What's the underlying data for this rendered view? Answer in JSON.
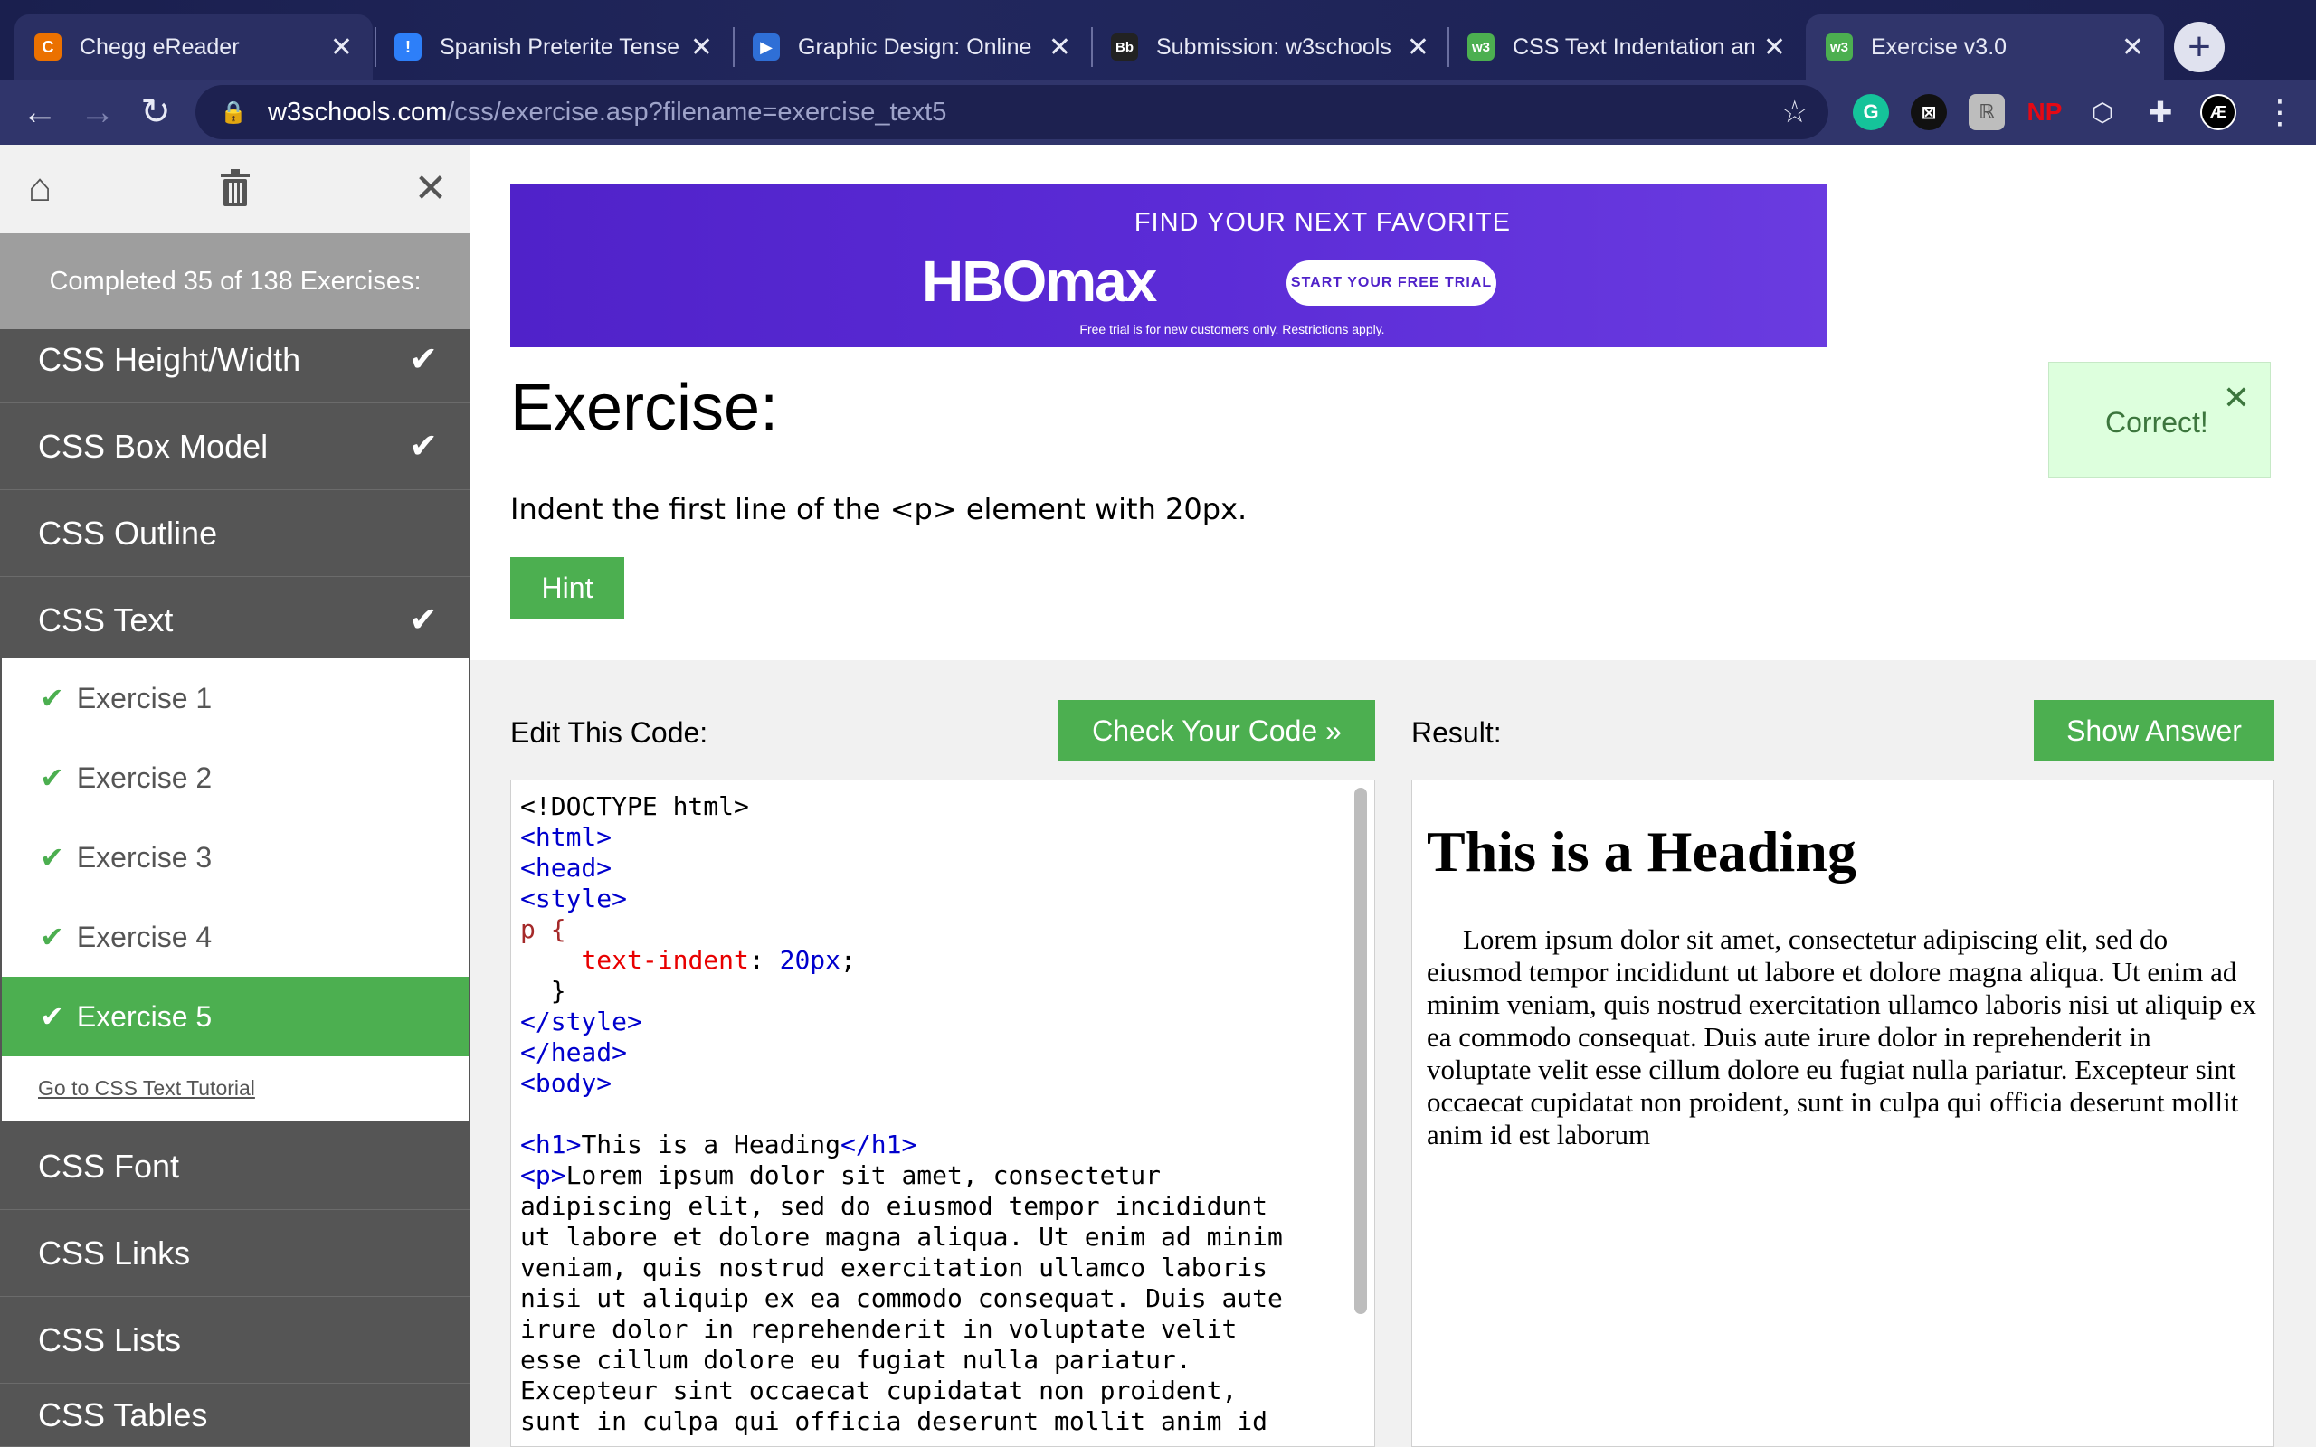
{
  "browser": {
    "tabs": [
      {
        "title": "Chegg eReader",
        "favicon": "C",
        "favicon_color": "#eb7100"
      },
      {
        "title": "Spanish Preterite Tense",
        "favicon": "!",
        "favicon_color": "#2d7ff9"
      },
      {
        "title": "Graphic Design: Online",
        "favicon": "▶",
        "favicon_color": "#2f6fd6"
      },
      {
        "title": "Submission: w3schools",
        "favicon": "Bb",
        "favicon_color": "#222222"
      },
      {
        "title": "CSS Text Indentation an",
        "favicon": "w3",
        "favicon_color": "#4caf50"
      },
      {
        "title": "Exercise v3.0",
        "favicon": "w3",
        "favicon_color": "#4caf50"
      }
    ],
    "url_host": "w3schools.com",
    "url_path": "/css/exercise.asp?filename=exercise_text5",
    "extensions": [
      "G",
      "⊠",
      "ℝ",
      "NP",
      "⬡",
      "✚",
      "Æ"
    ]
  },
  "sidebar": {
    "progress": "Completed 35 of 138 Exercises:",
    "topics_top": [
      {
        "label": "CSS Height/Width",
        "done": "✔"
      },
      {
        "label": "CSS Box Model",
        "done": "✔"
      },
      {
        "label": "CSS Outline",
        "done": ""
      },
      {
        "label": "CSS Text",
        "done": "✔"
      }
    ],
    "subitems": [
      {
        "label": "Exercise 1"
      },
      {
        "label": "Exercise 2"
      },
      {
        "label": "Exercise 3"
      },
      {
        "label": "Exercise 4"
      },
      {
        "label": "Exercise 5"
      }
    ],
    "tutorial_link": "Go to CSS Text Tutorial",
    "topics_bottom": [
      {
        "label": "CSS Font"
      },
      {
        "label": "CSS Links"
      },
      {
        "label": "CSS Lists"
      },
      {
        "label": "CSS Tables"
      }
    ]
  },
  "ad": {
    "line1": "FIND YOUR NEXT FAVORITE",
    "logo": "HBOmax",
    "cta": "START YOUR FREE TRIAL",
    "fine": "Free trial is for new customers only. Restrictions apply."
  },
  "exercise": {
    "title": "Exercise:",
    "description": "Indent the first line of the <p> element with 20px.",
    "hint": "Hint",
    "correct": "Correct!",
    "edit_label": "Edit This Code:",
    "check_button": "Check Your Code »",
    "result_label": "Result:",
    "answer_button": "Show Answer"
  },
  "code": {
    "doctype": "<!DOCTYPE html>",
    "html_open": "<html>",
    "head_open": "<head>",
    "style_open": "<style>",
    "selector": "p {",
    "prop": "text-indent",
    "value": "20px",
    "close_brace": "}",
    "style_close": "</style>",
    "head_close": "</head>",
    "body_open": "<body>",
    "h1_open": "<h1>",
    "h1_text": "This is a Heading",
    "h1_close": "</h1>",
    "p_open": "<p>",
    "p_lines": [
      "Lorem ipsum dolor sit amet, consectetur",
      "adipiscing elit, sed do eiusmod tempor incididunt",
      "ut labore et dolore magna aliqua. Ut enim ad minim",
      "veniam, quis nostrud exercitation ullamco laboris",
      "nisi ut aliquip ex ea commodo consequat. Duis aute",
      "irure dolor in reprehenderit in voluptate velit",
      "esse cillum dolore eu fugiat nulla pariatur.",
      "Excepteur sint occaecat cupidatat non proident,",
      "sunt in culpa qui officia deserunt mollit anim id"
    ]
  },
  "result": {
    "heading": "This is a Heading",
    "paragraph": "Lorem ipsum dolor sit amet, consectetur adipiscing elit, sed do eiusmod tempor incididunt ut labore et dolore magna aliqua. Ut enim ad minim veniam, quis nostrud exercitation ullamco laboris nisi ut aliquip ex ea commodo consequat. Duis aute irure dolor in reprehenderit in voluptate velit esse cillum dolore eu fugiat nulla pariatur. Excepteur sint occaecat cupidatat non proident, sunt in culpa qui officia deserunt mollit anim id est laborum"
  }
}
